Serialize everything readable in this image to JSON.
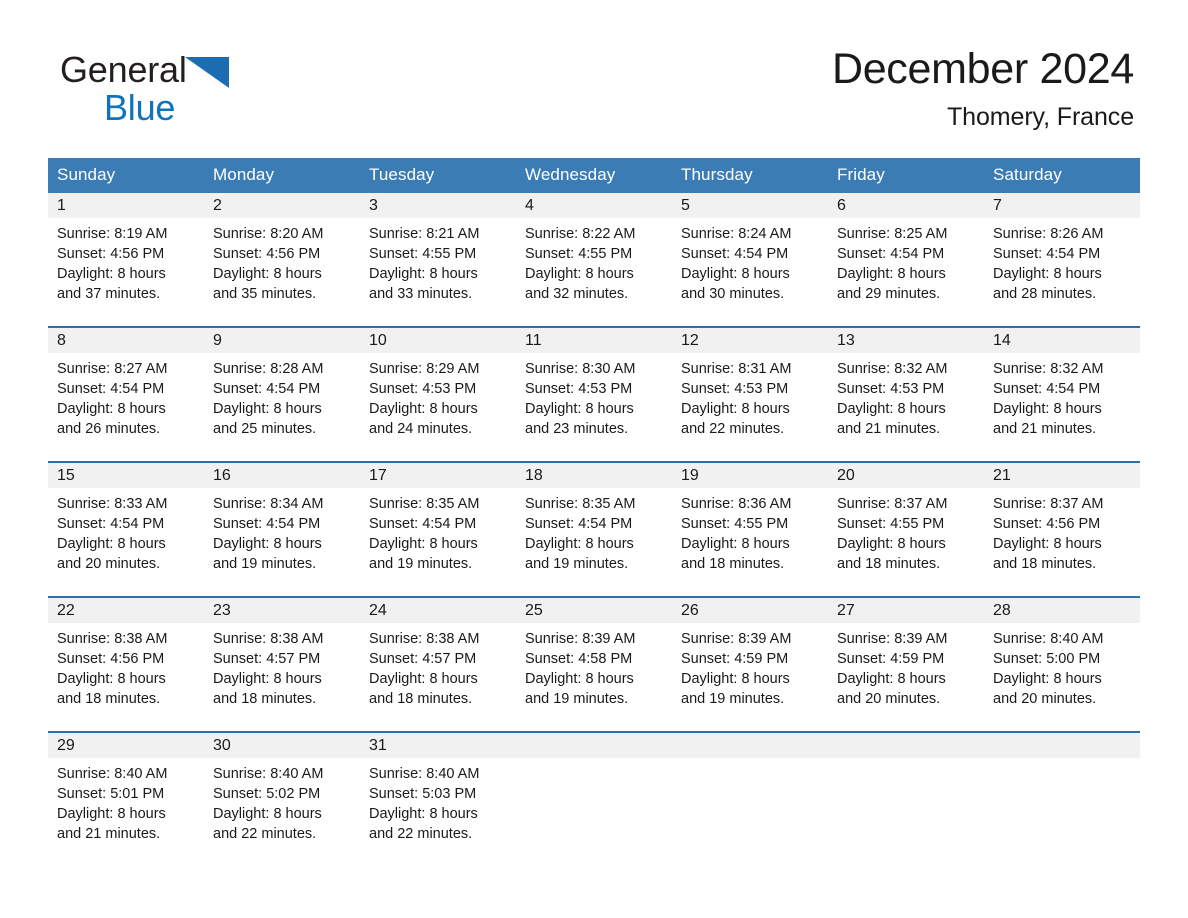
{
  "brand": {
    "word1": "General",
    "word2": "Blue",
    "triangle_color": "#1b6cb0",
    "word2_color": "#0f74bd",
    "icon": "triangle-logo-icon"
  },
  "header": {
    "title": "December 2024",
    "location": "Thomery, France"
  },
  "theme": {
    "header_row_bg": "#3b7cb5",
    "header_row_text": "#ffffff",
    "week_divider": "#2f6fa8",
    "daynum_band_bg": "#f1f1f1",
    "body_text": "#1a1a1a"
  },
  "weekdays": [
    "Sunday",
    "Monday",
    "Tuesday",
    "Wednesday",
    "Thursday",
    "Friday",
    "Saturday"
  ],
  "weeks": [
    [
      {
        "day": "1",
        "sunrise": "Sunrise: 8:19 AM",
        "sunset": "Sunset: 4:56 PM",
        "daylight_line1": "Daylight: 8 hours",
        "daylight_line2": "and 37 minutes."
      },
      {
        "day": "2",
        "sunrise": "Sunrise: 8:20 AM",
        "sunset": "Sunset: 4:56 PM",
        "daylight_line1": "Daylight: 8 hours",
        "daylight_line2": "and 35 minutes."
      },
      {
        "day": "3",
        "sunrise": "Sunrise: 8:21 AM",
        "sunset": "Sunset: 4:55 PM",
        "daylight_line1": "Daylight: 8 hours",
        "daylight_line2": "and 33 minutes."
      },
      {
        "day": "4",
        "sunrise": "Sunrise: 8:22 AM",
        "sunset": "Sunset: 4:55 PM",
        "daylight_line1": "Daylight: 8 hours",
        "daylight_line2": "and 32 minutes."
      },
      {
        "day": "5",
        "sunrise": "Sunrise: 8:24 AM",
        "sunset": "Sunset: 4:54 PM",
        "daylight_line1": "Daylight: 8 hours",
        "daylight_line2": "and 30 minutes."
      },
      {
        "day": "6",
        "sunrise": "Sunrise: 8:25 AM",
        "sunset": "Sunset: 4:54 PM",
        "daylight_line1": "Daylight: 8 hours",
        "daylight_line2": "and 29 minutes."
      },
      {
        "day": "7",
        "sunrise": "Sunrise: 8:26 AM",
        "sunset": "Sunset: 4:54 PM",
        "daylight_line1": "Daylight: 8 hours",
        "daylight_line2": "and 28 minutes."
      }
    ],
    [
      {
        "day": "8",
        "sunrise": "Sunrise: 8:27 AM",
        "sunset": "Sunset: 4:54 PM",
        "daylight_line1": "Daylight: 8 hours",
        "daylight_line2": "and 26 minutes."
      },
      {
        "day": "9",
        "sunrise": "Sunrise: 8:28 AM",
        "sunset": "Sunset: 4:54 PM",
        "daylight_line1": "Daylight: 8 hours",
        "daylight_line2": "and 25 minutes."
      },
      {
        "day": "10",
        "sunrise": "Sunrise: 8:29 AM",
        "sunset": "Sunset: 4:53 PM",
        "daylight_line1": "Daylight: 8 hours",
        "daylight_line2": "and 24 minutes."
      },
      {
        "day": "11",
        "sunrise": "Sunrise: 8:30 AM",
        "sunset": "Sunset: 4:53 PM",
        "daylight_line1": "Daylight: 8 hours",
        "daylight_line2": "and 23 minutes."
      },
      {
        "day": "12",
        "sunrise": "Sunrise: 8:31 AM",
        "sunset": "Sunset: 4:53 PM",
        "daylight_line1": "Daylight: 8 hours",
        "daylight_line2": "and 22 minutes."
      },
      {
        "day": "13",
        "sunrise": "Sunrise: 8:32 AM",
        "sunset": "Sunset: 4:53 PM",
        "daylight_line1": "Daylight: 8 hours",
        "daylight_line2": "and 21 minutes."
      },
      {
        "day": "14",
        "sunrise": "Sunrise: 8:32 AM",
        "sunset": "Sunset: 4:54 PM",
        "daylight_line1": "Daylight: 8 hours",
        "daylight_line2": "and 21 minutes."
      }
    ],
    [
      {
        "day": "15",
        "sunrise": "Sunrise: 8:33 AM",
        "sunset": "Sunset: 4:54 PM",
        "daylight_line1": "Daylight: 8 hours",
        "daylight_line2": "and 20 minutes."
      },
      {
        "day": "16",
        "sunrise": "Sunrise: 8:34 AM",
        "sunset": "Sunset: 4:54 PM",
        "daylight_line1": "Daylight: 8 hours",
        "daylight_line2": "and 19 minutes."
      },
      {
        "day": "17",
        "sunrise": "Sunrise: 8:35 AM",
        "sunset": "Sunset: 4:54 PM",
        "daylight_line1": "Daylight: 8 hours",
        "daylight_line2": "and 19 minutes."
      },
      {
        "day": "18",
        "sunrise": "Sunrise: 8:35 AM",
        "sunset": "Sunset: 4:54 PM",
        "daylight_line1": "Daylight: 8 hours",
        "daylight_line2": "and 19 minutes."
      },
      {
        "day": "19",
        "sunrise": "Sunrise: 8:36 AM",
        "sunset": "Sunset: 4:55 PM",
        "daylight_line1": "Daylight: 8 hours",
        "daylight_line2": "and 18 minutes."
      },
      {
        "day": "20",
        "sunrise": "Sunrise: 8:37 AM",
        "sunset": "Sunset: 4:55 PM",
        "daylight_line1": "Daylight: 8 hours",
        "daylight_line2": "and 18 minutes."
      },
      {
        "day": "21",
        "sunrise": "Sunrise: 8:37 AM",
        "sunset": "Sunset: 4:56 PM",
        "daylight_line1": "Daylight: 8 hours",
        "daylight_line2": "and 18 minutes."
      }
    ],
    [
      {
        "day": "22",
        "sunrise": "Sunrise: 8:38 AM",
        "sunset": "Sunset: 4:56 PM",
        "daylight_line1": "Daylight: 8 hours",
        "daylight_line2": "and 18 minutes."
      },
      {
        "day": "23",
        "sunrise": "Sunrise: 8:38 AM",
        "sunset": "Sunset: 4:57 PM",
        "daylight_line1": "Daylight: 8 hours",
        "daylight_line2": "and 18 minutes."
      },
      {
        "day": "24",
        "sunrise": "Sunrise: 8:38 AM",
        "sunset": "Sunset: 4:57 PM",
        "daylight_line1": "Daylight: 8 hours",
        "daylight_line2": "and 18 minutes."
      },
      {
        "day": "25",
        "sunrise": "Sunrise: 8:39 AM",
        "sunset": "Sunset: 4:58 PM",
        "daylight_line1": "Daylight: 8 hours",
        "daylight_line2": "and 19 minutes."
      },
      {
        "day": "26",
        "sunrise": "Sunrise: 8:39 AM",
        "sunset": "Sunset: 4:59 PM",
        "daylight_line1": "Daylight: 8 hours",
        "daylight_line2": "and 19 minutes."
      },
      {
        "day": "27",
        "sunrise": "Sunrise: 8:39 AM",
        "sunset": "Sunset: 4:59 PM",
        "daylight_line1": "Daylight: 8 hours",
        "daylight_line2": "and 20 minutes."
      },
      {
        "day": "28",
        "sunrise": "Sunrise: 8:40 AM",
        "sunset": "Sunset: 5:00 PM",
        "daylight_line1": "Daylight: 8 hours",
        "daylight_line2": "and 20 minutes."
      }
    ],
    [
      {
        "day": "29",
        "sunrise": "Sunrise: 8:40 AM",
        "sunset": "Sunset: 5:01 PM",
        "daylight_line1": "Daylight: 8 hours",
        "daylight_line2": "and 21 minutes."
      },
      {
        "day": "30",
        "sunrise": "Sunrise: 8:40 AM",
        "sunset": "Sunset: 5:02 PM",
        "daylight_line1": "Daylight: 8 hours",
        "daylight_line2": "and 22 minutes."
      },
      {
        "day": "31",
        "sunrise": "Sunrise: 8:40 AM",
        "sunset": "Sunset: 5:03 PM",
        "daylight_line1": "Daylight: 8 hours",
        "daylight_line2": "and 22 minutes."
      },
      {
        "day": "",
        "sunrise": "",
        "sunset": "",
        "daylight_line1": "",
        "daylight_line2": ""
      },
      {
        "day": "",
        "sunrise": "",
        "sunset": "",
        "daylight_line1": "",
        "daylight_line2": ""
      },
      {
        "day": "",
        "sunrise": "",
        "sunset": "",
        "daylight_line1": "",
        "daylight_line2": ""
      },
      {
        "day": "",
        "sunrise": "",
        "sunset": "",
        "daylight_line1": "",
        "daylight_line2": ""
      }
    ]
  ]
}
